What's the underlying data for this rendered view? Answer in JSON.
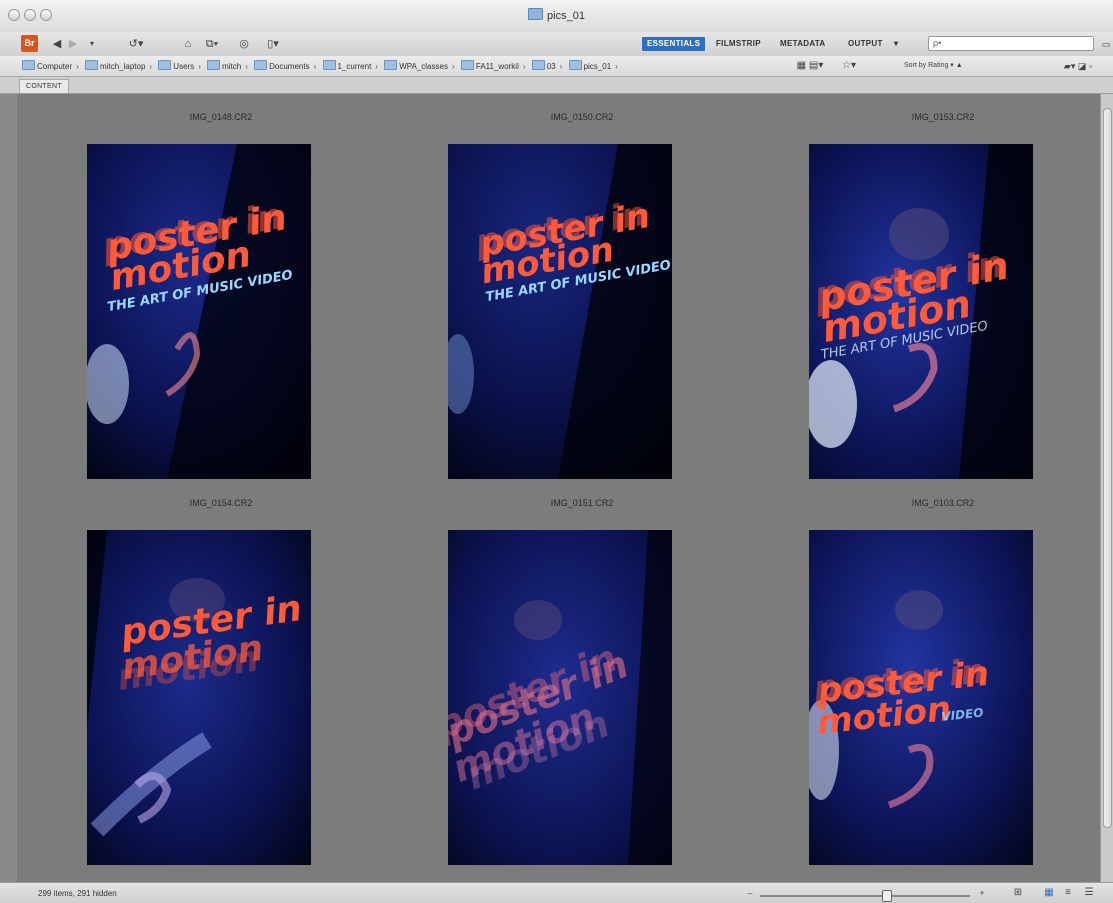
{
  "window": {
    "title": "pics_01"
  },
  "toolbar": {
    "app_icon": "Br",
    "back_icon": "back-arrow-icon",
    "forward_icon": "forward-arrow-icon",
    "workspaces": [
      "ESSENTIALS",
      "FILMSTRIP",
      "METADATA",
      "OUTPUT"
    ],
    "active_workspace": "ESSENTIALS",
    "output_menu_glyph": "▾",
    "search_placeholder": "ρ•"
  },
  "path": {
    "crumbs": [
      "Computer",
      "mitch_laptop",
      "Users",
      "mitch",
      "Documents",
      "1_current",
      "WPA_classes",
      "FA11_workil",
      "03",
      "pics_01"
    ],
    "sort_label": "Sort by Rating"
  },
  "panel": {
    "tab_label": "CONTENT"
  },
  "thumbnails": [
    {
      "filename": "IMG_0148.CR2",
      "line1": "poster in",
      "line2": "motion",
      "line3": "THE ART OF MUSIC VIDEO"
    },
    {
      "filename": "IMG_0150.CR2",
      "line1": "poster in",
      "line2": "motion",
      "line3": "THE ART OF MUSIC VIDEO"
    },
    {
      "filename": "IMG_0153.CR2",
      "line1": "poster in",
      "line2": "motion",
      "line3": "THE ART OF MUSIC VIDEO"
    },
    {
      "filename": "IMG_0154.CR2",
      "line1": "poster in",
      "line2": "motion",
      "line3": ""
    },
    {
      "filename": "IMG_0151.CR2",
      "line1": "poster in",
      "line2": "motion",
      "line3": ""
    },
    {
      "filename": "IMG_0103.CR2",
      "line1": "poster in",
      "line2": "motion",
      "line3": "VIDEO"
    }
  ],
  "status": {
    "text": "299 items, 291 hidden",
    "zoom_fraction": 0.6
  },
  "colors": {
    "accent": "#2f6fbf",
    "poster_text": "#ff5a3a",
    "subtitle_text": "#9ad8ff",
    "content_bg": "#7c7c7c"
  }
}
